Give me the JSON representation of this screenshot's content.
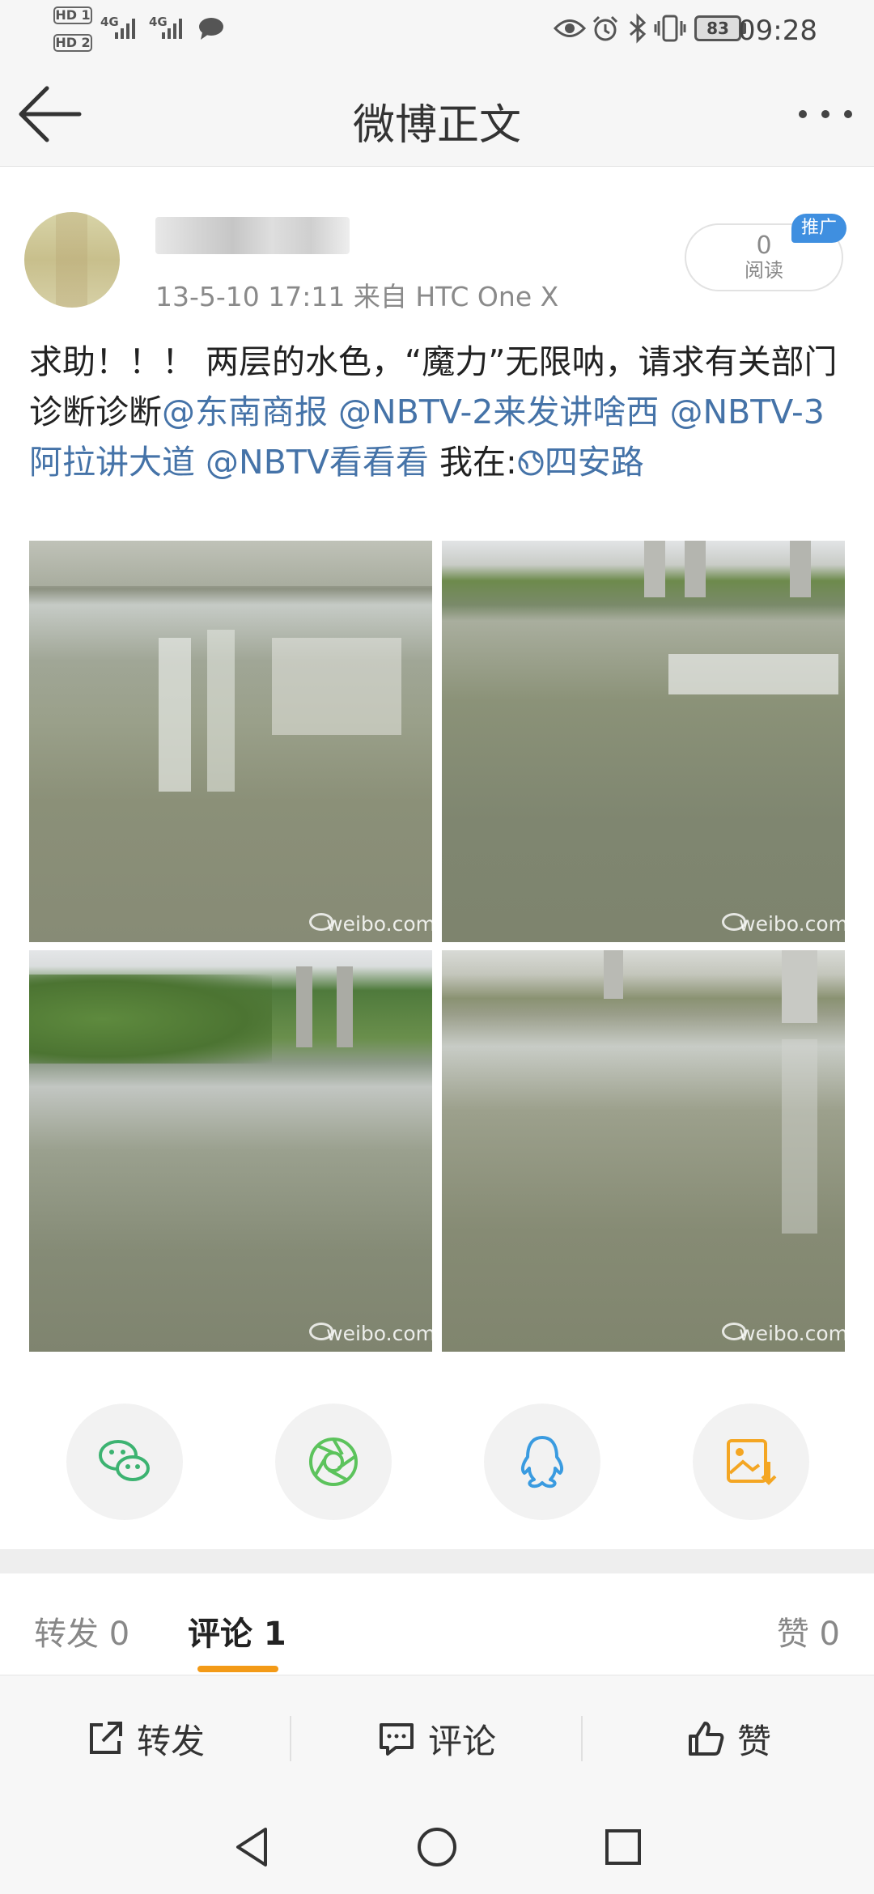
{
  "status_bar": {
    "sim1": "HD 1",
    "sim2": "HD 2",
    "net1": "4G",
    "net2": "4G",
    "battery": "83",
    "time": "09:28"
  },
  "header": {
    "title": "微博正文",
    "back_icon": "arrow-left-icon",
    "more_icon": "more-dots-icon"
  },
  "post": {
    "meta": "13-5-10 17:11  来自 HTC One X",
    "read_count": "0",
    "read_label": "阅读",
    "promo_badge": "推广",
    "text_plain_1": "求助！！！ 两层的水色，“魔力”无限呐，请求有关部门诊断诊断",
    "mention_1": "@东南商报",
    "mention_2": "@NBTV-2来发讲啥西",
    "mention_3": "@NBTV-3阿拉讲大道",
    "mention_4": "@NBTV看看看",
    "location_prefix": "我在:",
    "location": "四安路",
    "photos": [
      {
        "watermark": "weibo.com"
      },
      {
        "watermark": "weibo.com"
      },
      {
        "watermark": "weibo.com"
      },
      {
        "watermark": "weibo.com"
      }
    ]
  },
  "share": {
    "items": [
      "wechat-icon",
      "moments-icon",
      "qq-icon",
      "save-image-icon"
    ],
    "colors": {
      "wechat": "#3cb371",
      "moments": "#5cc35c",
      "qq": "#3a9be0",
      "save": "#f4a623"
    }
  },
  "tabs": {
    "repost": "转发 0",
    "comment": "评论 1",
    "like": "赞 0",
    "accent": "#f39a17"
  },
  "actions": {
    "repost": "转发",
    "comment": "评论",
    "like": "赞"
  },
  "nav": {
    "back": "triangle-back-icon",
    "home": "circle-home-icon",
    "recent": "square-recent-icon"
  }
}
